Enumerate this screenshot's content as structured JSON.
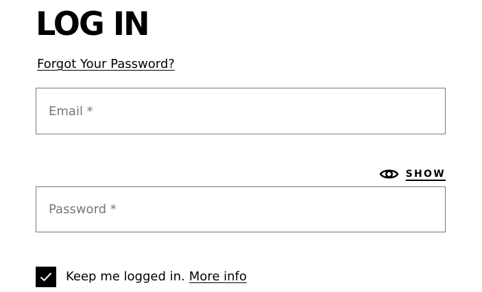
{
  "login": {
    "title": "LOG IN",
    "forgot_password_link": "Forgot Your Password?",
    "email": {
      "placeholder": "Email *",
      "value": ""
    },
    "password": {
      "placeholder": "Password *",
      "value": "",
      "show_toggle_label": "SHOW",
      "show_toggle_icon": "eye-icon"
    },
    "keep_logged_in": {
      "label": "Keep me logged in.",
      "checked": true,
      "more_info_link": "More info",
      "check_icon": "check-icon"
    }
  },
  "colors": {
    "text": "#000000",
    "border": "#767677",
    "placeholder": "#767677",
    "background": "#ffffff",
    "checkbox_fill": "#000000"
  }
}
